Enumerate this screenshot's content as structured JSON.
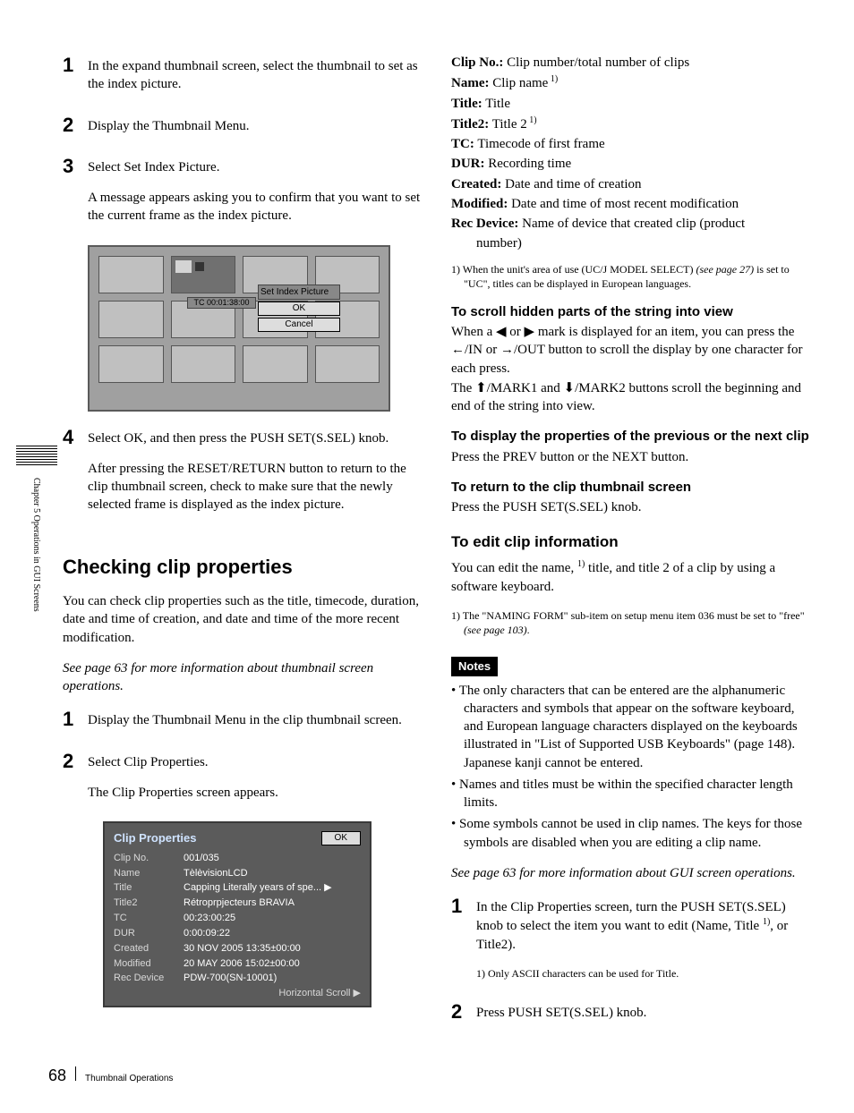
{
  "sidebar": {
    "label": "Chapter 5  Operations in GUI Screens"
  },
  "footer": {
    "page_number": "68",
    "title": "Thumbnail Operations"
  },
  "left": {
    "steps_a": [
      {
        "num": "1",
        "text": "In the expand thumbnail screen, select the thumbnail to set as the index picture."
      },
      {
        "num": "2",
        "text": "Display the Thumbnail Menu."
      },
      {
        "num": "3",
        "text": "Select Set Index Picture."
      }
    ],
    "step3_followup": "A message appears asking you to confirm that you want to set the current frame as the index picture.",
    "shot1": {
      "tc": "TC 00:01:38:00",
      "popup_title": "Set Index Picture",
      "ok": "OK",
      "cancel": "Cancel"
    },
    "step4_num": "4",
    "step4_text": "Select OK, and then press the PUSH SET(S.SEL) knob.",
    "step4_followup": "After pressing the RESET/RETURN button to return to the clip thumbnail screen, check to make sure that the newly selected frame is displayed as the index picture.",
    "section_title": "Checking clip properties",
    "section_intro": "You can check clip properties such as the title, timecode, duration, date and time of creation, and date and time of the more recent modification.",
    "section_seealso": "See page 63 for more information about thumbnail screen operations.",
    "steps_b": [
      {
        "num": "1",
        "text": "Display the Thumbnail Menu in the clip thumbnail screen."
      },
      {
        "num": "2",
        "text": "Select Clip Properties."
      }
    ],
    "stepb_followup": "The Clip Properties screen appears.",
    "shot2": {
      "title": "Clip Properties",
      "ok": "OK",
      "rows": [
        {
          "lab": "Clip No.",
          "val": "001/035"
        },
        {
          "lab": "Name",
          "val": "TèlèvisionLCD"
        },
        {
          "lab": "Title",
          "val": "Capping Literally years of spe... ▶"
        },
        {
          "lab": "Title2",
          "val": "Rétroprpjecteurs BRAVIA"
        },
        {
          "lab": "TC",
          "val": "00:23:00:25"
        },
        {
          "lab": "DUR",
          "val": "0:00:09:22"
        },
        {
          "lab": "Created",
          "val": "30 NOV 2005 13:35±00:00"
        },
        {
          "lab": "Modified",
          "val": "20 MAY 2006 15:02±00:00"
        },
        {
          "lab": "Rec Device",
          "val": "PDW-700(SN-10001)"
        }
      ],
      "footer": "Horizontal Scroll ▶"
    }
  },
  "right": {
    "defs": [
      {
        "k": "Clip No.:",
        "v": " Clip number/total number of clips",
        "sup": ""
      },
      {
        "k": "Name:",
        "v": " Clip name",
        "sup": " 1)"
      },
      {
        "k": "Title:",
        "v": " Title",
        "sup": ""
      },
      {
        "k": "Title2:",
        "v": " Title 2",
        "sup": " 1)"
      },
      {
        "k": "TC:",
        "v": " Timecode of first frame",
        "sup": ""
      },
      {
        "k": "DUR:",
        "v": " Recording time",
        "sup": ""
      },
      {
        "k": "Created:",
        "v": " Date and time of creation",
        "sup": ""
      },
      {
        "k": "Modified:",
        "v": " Date and time of most recent modification",
        "sup": ""
      },
      {
        "k": "Rec Device:",
        "v": " Name of device that created clip (product",
        "sup": ""
      }
    ],
    "def_cont": "number)",
    "footnote1_a": "1)  When the unit's area of use (UC/J MODEL SELECT) ",
    "footnote1_see": "(see page 27)",
    "footnote1_b": " is set to \"UC\", titles can be displayed in European languages.",
    "h_scroll_title": "To scroll hidden parts of the string into view",
    "h_scroll_p1_a": "When a ",
    "h_scroll_p1_b": " or ",
    "h_scroll_p1_c": " mark is displayed for an item, you can press the ",
    "h_scroll_p1_d": "/IN or ",
    "h_scroll_p1_e": "/OUT button to scroll the display by one character for each press.",
    "h_scroll_p2_a": "The ",
    "h_scroll_p2_b": "/MARK1 and ",
    "h_scroll_p2_c": "/MARK2 buttons scroll the beginning and end of the string into view.",
    "h_prevnext_title": "To display the properties of the previous or the next clip",
    "h_prevnext_body": "Press the PREV button or the NEXT button.",
    "h_return_title": "To return to the clip thumbnail screen",
    "h_return_body": "Press the PUSH SET(S.SEL) knob.",
    "h_edit_title": "To edit clip information",
    "h_edit_body_a": "You can edit the name, ",
    "h_edit_body_sup": "1)",
    "h_edit_body_b": " title, and title 2 of a clip by using a software keyboard.",
    "edit_footnote_a": "1) The \"NAMING FORM\" sub-item on setup menu item 036 must be set to \"free\" ",
    "edit_footnote_see": "(see page 103)",
    "edit_footnote_b": ".",
    "notes_label": "Notes",
    "notes": [
      "The only characters that can be entered are the alphanumeric characters and symbols that appear on the software keyboard, and European language characters displayed on the keyboards illustrated in \"List of Supported USB Keyboards\" (page 148). Japanese kanji cannot be entered.",
      "Names and titles must be within the specified character length limits.",
      "Some symbols cannot be used in clip names. The keys for those symbols are disabled when you are editing a clip name."
    ],
    "seealso2": "See page 63 for more information about GUI screen operations.",
    "steps_c": [
      {
        "num": "1",
        "text_a": "In the Clip Properties screen, turn the PUSH SET(S.SEL) knob to select the item you want to edit (Name, Title ",
        "sup": "1)",
        "text_b": ", or Title2)."
      },
      {
        "num": "2",
        "text_a": "Press PUSH SET(S.SEL) knob.",
        "sup": "",
        "text_b": ""
      }
    ],
    "stepc_footnote": "1) Only ASCII characters can be used for Title."
  },
  "glyph": {
    "tri_left": "◀",
    "tri_right": "▶",
    "arr_left": "←",
    "arr_right": "→",
    "arr_up_solid": "⬆",
    "arr_down_solid": "⬇"
  }
}
